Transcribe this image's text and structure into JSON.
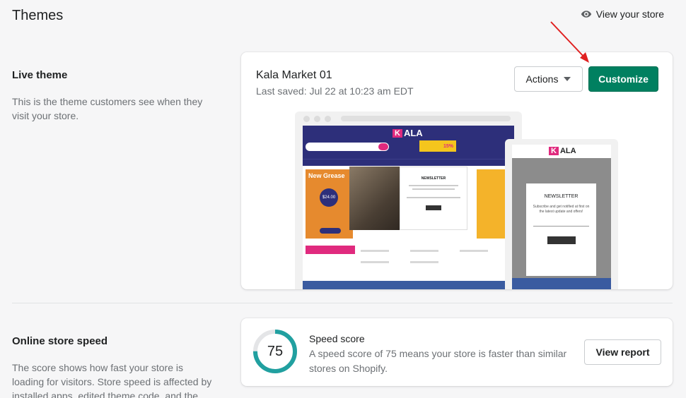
{
  "header": {
    "title": "Themes",
    "view_store_label": "View your store"
  },
  "live_theme": {
    "section_title": "Live theme",
    "section_desc": "This is the theme customers see when they visit your store.",
    "theme_name": "Kala Market 01",
    "last_saved": "Last saved: Jul 22 at 10:23 am EDT",
    "actions_label": "Actions",
    "customize_label": "Customize",
    "preview": {
      "logo_letter": "K",
      "logo_text": "ALA",
      "promo_text": "15%",
      "hero_title": "New Grease",
      "hero_price": "$24.00",
      "newsletter_title": "NEWSLETTER",
      "mobile_newsletter_title": "NEWSLETTER",
      "mobile_newsletter_desc": "Subscribe and get notified at first on the latest update and offers!"
    }
  },
  "speed": {
    "section_title": "Online store speed",
    "section_desc": "The score shows how fast your store is loading for visitors. Store speed is affected by installed apps, edited theme code, and the",
    "score": "75",
    "score_fraction": 0.75,
    "score_title": "Speed score",
    "score_desc": "A speed score of 75 means your store is faster than similar stores on Shopify.",
    "view_report_label": "View report"
  },
  "colors": {
    "primary": "#008060",
    "gauge": "#21a0a0",
    "gauge_track": "#e4e5e7",
    "annotation_arrow": "#e02020"
  },
  "icons": {
    "view_store": "eye-icon",
    "actions": "caret-down-icon"
  }
}
